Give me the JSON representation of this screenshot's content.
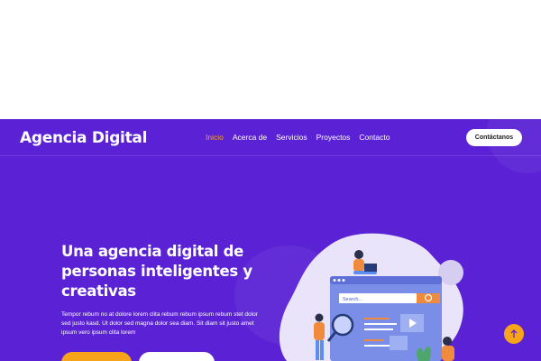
{
  "header": {
    "logo": "Agencia Digital",
    "nav": [
      {
        "label": "Inicio",
        "active": true
      },
      {
        "label": "Acerca de",
        "active": false
      },
      {
        "label": "Servicios",
        "active": false
      },
      {
        "label": "Proyectos",
        "active": false
      },
      {
        "label": "Contacto",
        "active": false
      }
    ],
    "contact_button": "Contáctanos"
  },
  "hero": {
    "title": "Una agencia digital de personas inteligentes y creativas",
    "description": "Tempor rebum no at dolore lorem clita rebum rebum ipsum rebum stet dolor sed justo kasd. Ut dolor sed magna dolor sea diam. Sit diam sit justo amet ipsum vero ipsum clita lorem",
    "search_placeholder": "Search..."
  },
  "colors": {
    "hero_background": "#5a22d4",
    "accent": "#f7a41b",
    "nav_active": "#f7a41b"
  },
  "icons": {
    "scroll_top": "arrow-up-icon",
    "search": "magnifier-icon"
  }
}
